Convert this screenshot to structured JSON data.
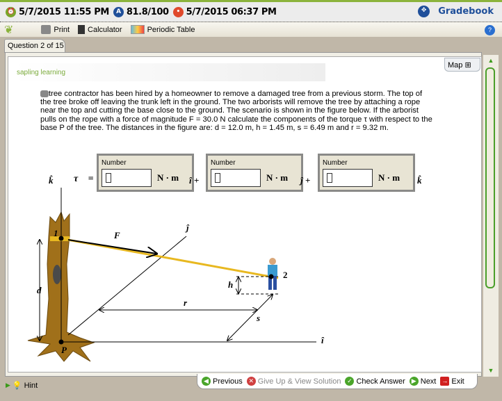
{
  "header": {
    "due_date": "5/7/2015 11:55 PM",
    "score": "81.8/100",
    "last_date": "5/7/2015 06:37 PM",
    "gradebook": "Gradebook"
  },
  "toolbar": {
    "print": "Print",
    "calculator": "Calculator",
    "periodic_table": "Periodic Table",
    "help": "?"
  },
  "tab": {
    "label": "Question 2 of 15"
  },
  "logo": {
    "text": "sapling learning"
  },
  "map": {
    "label": "Map"
  },
  "question": {
    "text": "tree contractor has been hired by a homeowner to remove a damaged tree from a previous storm. The top of the tree broke off leaving the trunk left in the ground. The two arborists will remove the tree by attaching a rope near the top and cutting the base close to the ground. The scenario is shown in the figure below. If the arborist pulls on the rope with a force of magnitude F = 30.0 N calculate the components of the torque τ with respect to the base P of the tree. The distances in the figure are: d = 12.0 m, h = 1.45 m, s = 6.49 m and r = 9.32 m."
  },
  "answer": {
    "k_left": "k̂",
    "tau": "τ⃗ =",
    "boxes": [
      {
        "label": "Number",
        "value": "",
        "unit": "N · m",
        "after": "î +"
      },
      {
        "label": "Number",
        "value": "",
        "unit": "N · m",
        "after": "ĵ +"
      },
      {
        "label": "Number",
        "value": "",
        "unit": "N · m",
        "after": "k̂"
      }
    ]
  },
  "figure": {
    "point1": "1",
    "point2": "2",
    "force": "F⃗",
    "j": "ĵ",
    "i": "î",
    "d": "d",
    "h": "h",
    "r": "r",
    "s": "s",
    "P": "P"
  },
  "footer": {
    "hint": "Hint",
    "previous": "Previous",
    "give_up": "Give Up & View Solution",
    "check": "Check Answer",
    "next": "Next",
    "exit": "Exit"
  }
}
